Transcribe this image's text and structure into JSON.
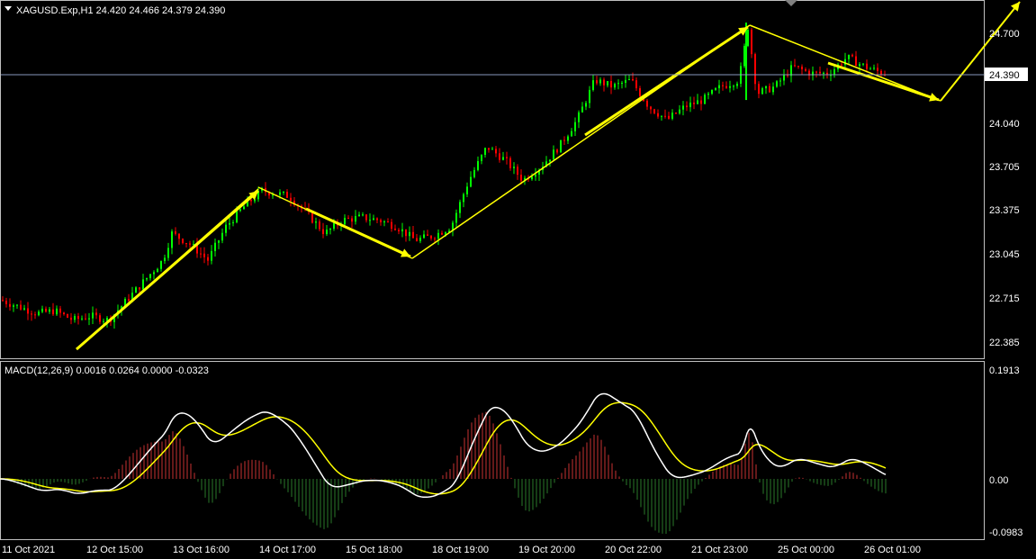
{
  "window": {
    "symbol_header": "XAGUSD.Exp,H1  24.420 24.466 24.379 24.390",
    "dropdown_icon": "triangle-down-icon"
  },
  "price_chart": {
    "symbol": "XAGUSD.Exp",
    "timeframe": "H1",
    "ohlc": {
      "open": 24.42,
      "high": 24.466,
      "low": 24.379,
      "close": 24.39
    },
    "current_price_label": "24.390",
    "axis_ticks": [
      "24.700",
      "24.040",
      "23.705",
      "23.375",
      "23.045",
      "22.715",
      "22.385"
    ],
    "colors": {
      "bull": "#00ff00",
      "bear": "#ff0000",
      "annotation": "#ffff00",
      "price_line": "#8899bb"
    }
  },
  "macd_panel": {
    "header": "MACD(12,26,9) 0.0016 0.0264 0.0000 -0.0323",
    "axis_ticks": [
      "0.1913",
      "0.00",
      "-0.0983"
    ],
    "colors": {
      "macd_line": "#ffffff",
      "signal_line": "#ffff00",
      "hist_up": "#c83232",
      "hist_down": "#2a7a2a"
    }
  },
  "time_axis": {
    "labels": [
      "11 Oct 2021",
      "12 Oct 15:00",
      "13 Oct 16:00",
      "14 Oct 17:00",
      "15 Oct 18:00",
      "18 Oct 19:00",
      "19 Oct 20:00",
      "20 Oct 22:00",
      "21 Oct 23:00",
      "25 Oct 00:00",
      "26 Oct 01:00"
    ]
  },
  "chart_data": [
    {
      "type": "candlestick",
      "title": "XAGUSD.Exp,H1",
      "series": [
        {
          "name": "XAGUSD.Exp",
          "close_path_approx": [
            [
              0,
              22.7
            ],
            [
              20,
              22.65
            ],
            [
              40,
              22.6
            ],
            [
              60,
              22.62
            ],
            [
              80,
              22.55
            ],
            [
              100,
              22.58
            ],
            [
              120,
              22.55
            ],
            [
              140,
              22.7
            ],
            [
              160,
              22.85
            ],
            [
              180,
              23.0
            ],
            [
              190,
              23.2
            ],
            [
              210,
              23.12
            ],
            [
              230,
              23.0
            ],
            [
              250,
              23.25
            ],
            [
              270,
              23.4
            ],
            [
              290,
              23.52
            ],
            [
              320,
              23.48
            ],
            [
              340,
              23.35
            ],
            [
              360,
              23.2
            ],
            [
              380,
              23.3
            ],
            [
              400,
              23.32
            ],
            [
              420,
              23.3
            ],
            [
              440,
              23.25
            ],
            [
              460,
              23.15
            ],
            [
              480,
              23.18
            ],
            [
              500,
              23.25
            ],
            [
              520,
              23.6
            ],
            [
              540,
              23.85
            ],
            [
              560,
              23.75
            ],
            [
              580,
              23.6
            ],
            [
              600,
              23.7
            ],
            [
              620,
              23.85
            ],
            [
              640,
              24.05
            ],
            [
              660,
              24.35
            ],
            [
              680,
              24.3
            ],
            [
              700,
              24.35
            ],
            [
              720,
              24.15
            ],
            [
              740,
              24.05
            ],
            [
              760,
              24.15
            ],
            [
              780,
              24.2
            ],
            [
              800,
              24.3
            ],
            [
              820,
              24.35
            ],
            [
              830,
              24.75
            ],
            [
              840,
              24.25
            ],
            [
              860,
              24.3
            ],
            [
              880,
              24.45
            ],
            [
              900,
              24.4
            ],
            [
              920,
              24.4
            ],
            [
              940,
              24.52
            ],
            [
              960,
              24.45
            ],
            [
              980,
              24.4
            ]
          ],
          "x_unit": "approximate screen column (hours-based index)"
        }
      ],
      "ylim": [
        22.3,
        24.9
      ]
    },
    {
      "type": "line",
      "title": "MACD(12,26,9)",
      "values_printed": {
        "main": 0.0016,
        "signal": 0.0264,
        "hist": 0.0,
        "extra": -0.0323
      },
      "ylim": [
        -0.0983,
        0.1913
      ]
    }
  ]
}
